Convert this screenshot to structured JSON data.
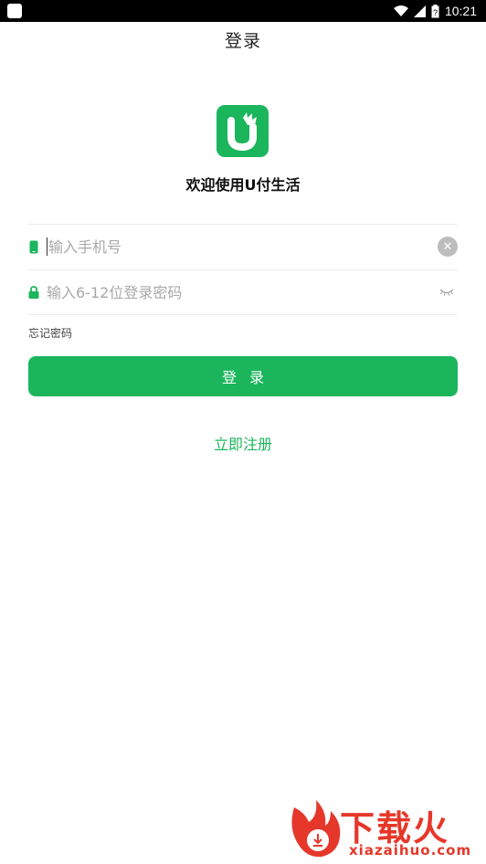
{
  "status_bar": {
    "time": "10:21"
  },
  "header": {
    "title": "登录"
  },
  "brand": {
    "welcome": "欢迎使用U付生活"
  },
  "form": {
    "phone_placeholder": "输入手机号",
    "password_placeholder": "输入6-12位登录密码",
    "forgot_label": "忘记密码",
    "login_label": "登录",
    "register_label": "立即注册"
  },
  "watermark": {
    "brand": "下载火",
    "site": "xiazaihuo.com"
  },
  "colors": {
    "accent": "#1bb55c",
    "watermark": "#e5382a"
  }
}
